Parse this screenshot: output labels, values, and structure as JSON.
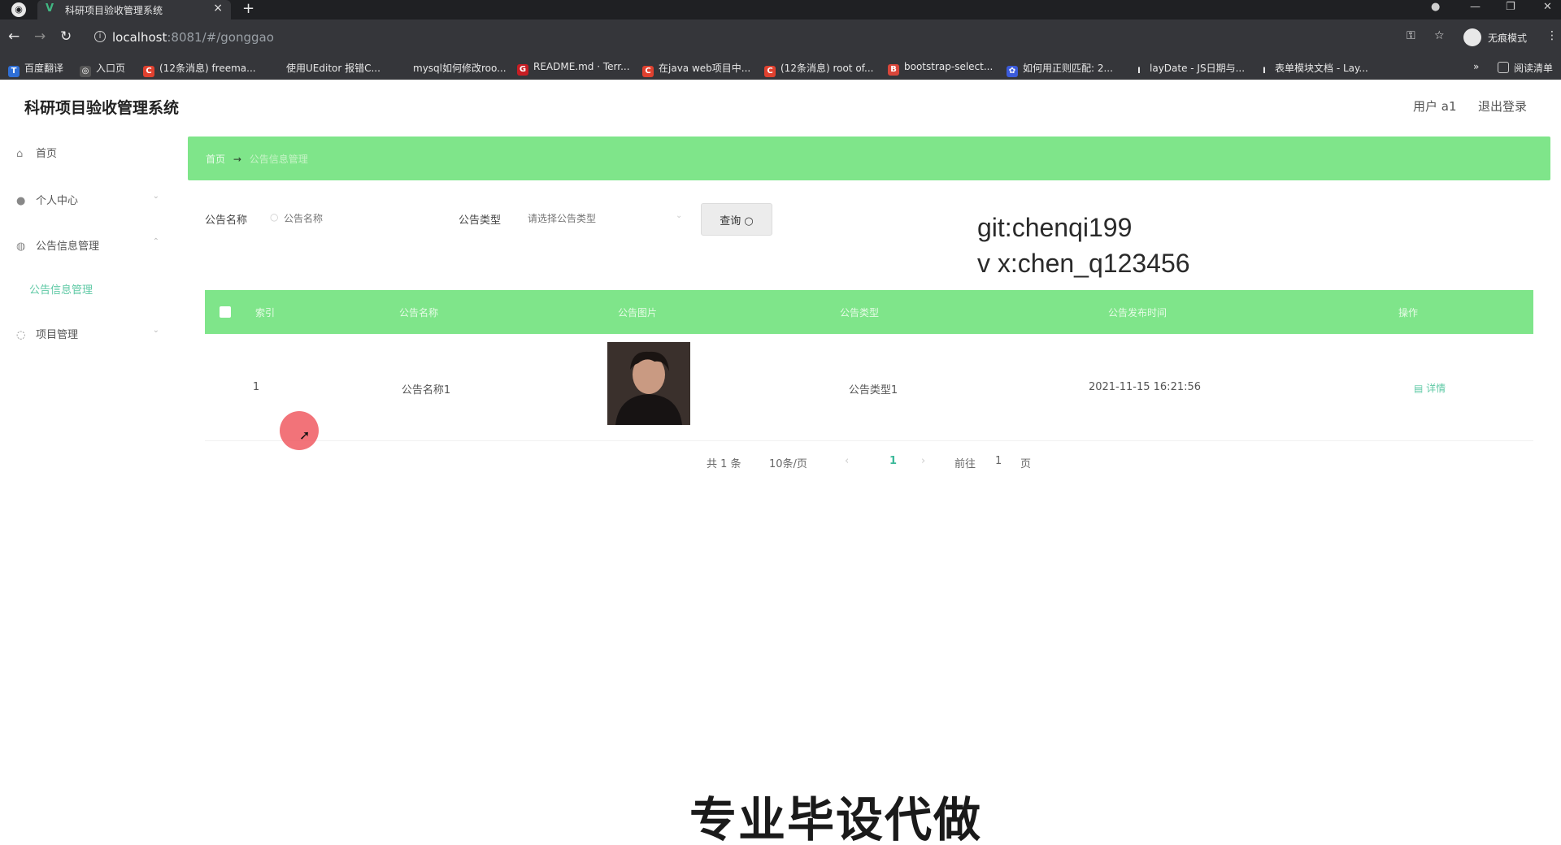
{
  "browser": {
    "tab_title": "科研项目验收管理系统",
    "tab_favicon": "V",
    "url_host": "localhost",
    "url_rest": ":8081/#/gonggao",
    "incognito_label": "无痕模式",
    "reading_list_label": "阅读清单",
    "bookmarks": [
      {
        "icon": "translate-icon",
        "label": "百度翻译",
        "color": "#2f6fd6"
      },
      {
        "icon": "globe-icon",
        "label": "入口页",
        "color": "#555555"
      },
      {
        "icon": "csdn-icon",
        "label": "(12条消息) freema...",
        "color": "#e0412f"
      },
      {
        "icon": "doc-icon",
        "label": "使用UEditor 报错C...",
        "color": "#35363a"
      },
      {
        "icon": "doc-icon",
        "label": "mysql如何修改roo...",
        "color": "#35363a"
      },
      {
        "icon": "gitee-icon",
        "label": "README.md · Terr...",
        "color": "#c71d23"
      },
      {
        "icon": "csdn-icon",
        "label": "在java web项目中...",
        "color": "#e0412f"
      },
      {
        "icon": "csdn-icon",
        "label": "(12条消息) root of...",
        "color": "#e0412f"
      },
      {
        "icon": "bootstrap-icon",
        "label": "bootstrap-select...",
        "color": "#d9463a"
      },
      {
        "icon": "baidu-icon",
        "label": "如何用正则匹配: 2...",
        "color": "#3b5bdb"
      },
      {
        "icon": "layui-icon",
        "label": "layDate - JS日期与...",
        "color": "#35363a"
      },
      {
        "icon": "layui-icon",
        "label": "表单模块文档 - Lay...",
        "color": "#35363a"
      }
    ]
  },
  "app": {
    "title": "科研项目验收管理系统",
    "user_label": "用户 a1",
    "logout_label": "退出登录"
  },
  "sidebar": {
    "items": [
      {
        "icon": "home-icon",
        "label": "首页"
      },
      {
        "icon": "user-icon",
        "label": "个人中心"
      },
      {
        "icon": "notice-icon",
        "label": "公告信息管理"
      },
      {
        "icon": "project-icon",
        "label": "项目管理"
      }
    ],
    "active_sub": "公告信息管理"
  },
  "breadcrumb": {
    "home": "首页",
    "current": "公告信息管理"
  },
  "search": {
    "name_label": "公告名称",
    "name_placeholder": "公告名称",
    "type_label": "公告类型",
    "type_placeholder": "请选择公告类型",
    "query_button": "查询"
  },
  "watermark": {
    "line1": "git:chenqi199",
    "line2": "v x:chen_q123456"
  },
  "table": {
    "headers": [
      "索引",
      "公告名称",
      "公告图片",
      "公告类型",
      "公告发布时间",
      "操作"
    ],
    "rows": [
      {
        "index": "1",
        "name": "公告名称1",
        "type": "公告类型1",
        "time": "2021-11-15 16:21:56",
        "action": "详情"
      }
    ]
  },
  "pagination": {
    "total": "共 1 条",
    "page_size": "10条/页",
    "current_page": "1",
    "goto_label": "前往",
    "goto_value": "1",
    "page_suffix": "页"
  },
  "caption": "专业毕设代做"
}
